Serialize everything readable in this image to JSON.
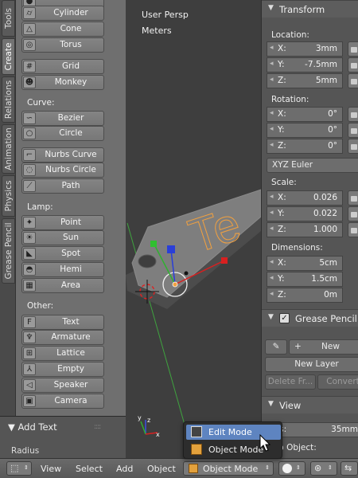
{
  "tabs": [
    {
      "label": "Tools",
      "active": false
    },
    {
      "label": "Create",
      "active": true
    },
    {
      "label": "Relations",
      "active": false
    },
    {
      "label": "Animation",
      "active": false
    },
    {
      "label": "Physics",
      "active": false
    },
    {
      "label": "Grease Pencil",
      "active": false
    }
  ],
  "toolshelf": {
    "buttons": [
      {
        "label": "Cylinder",
        "icon": "cylinder-icon",
        "glyph": "⌭"
      },
      {
        "label": "Cone",
        "icon": "cone-icon",
        "glyph": "△"
      },
      {
        "label": "Torus",
        "icon": "torus-icon",
        "glyph": "◎"
      },
      {
        "label": "Grid",
        "icon": "grid-icon",
        "glyph": "#"
      },
      {
        "label": "Monkey",
        "icon": "monkey-icon",
        "glyph": "☻"
      },
      {
        "label": "Bezier",
        "icon": "bezier-icon",
        "glyph": "∽"
      },
      {
        "label": "Circle",
        "icon": "circle-curve-icon",
        "glyph": "○"
      },
      {
        "label": "Nurbs Curve",
        "icon": "nurbs-curve-icon",
        "glyph": "⌐"
      },
      {
        "label": "Nurbs Circle",
        "icon": "nurbs-circle-icon",
        "glyph": "◌"
      },
      {
        "label": "Path",
        "icon": "path-icon",
        "glyph": "⟋"
      },
      {
        "label": "Point",
        "icon": "point-lamp-icon",
        "glyph": "✦"
      },
      {
        "label": "Sun",
        "icon": "sun-lamp-icon",
        "glyph": "☀"
      },
      {
        "label": "Spot",
        "icon": "spot-lamp-icon",
        "glyph": "◣"
      },
      {
        "label": "Hemi",
        "icon": "hemi-lamp-icon",
        "glyph": "◓"
      },
      {
        "label": "Area",
        "icon": "area-lamp-icon",
        "glyph": "▦"
      },
      {
        "label": "Text",
        "icon": "text-icon",
        "glyph": "F"
      },
      {
        "label": "Armature",
        "icon": "armature-icon",
        "glyph": "♆"
      },
      {
        "label": "Lattice",
        "icon": "lattice-icon",
        "glyph": "⊞"
      },
      {
        "label": "Empty",
        "icon": "empty-icon",
        "glyph": "⅄"
      },
      {
        "label": "Speaker",
        "icon": "speaker-icon",
        "glyph": "◁"
      },
      {
        "label": "Camera",
        "icon": "camera-icon",
        "glyph": "▣"
      }
    ],
    "section_curve": "Curve:",
    "section_lamp": "Lamp:",
    "section_other": "Other:"
  },
  "redo_panel": {
    "title": "Add Text",
    "field": "Radius"
  },
  "viewport": {
    "view_name": "User Persp",
    "units": "Meters",
    "object_text": "Te"
  },
  "properties": {
    "transform": {
      "title": "Transform",
      "location_label": "Location:",
      "location": [
        {
          "axis": "X:",
          "value": "3mm"
        },
        {
          "axis": "Y:",
          "value": "-7.5mm"
        },
        {
          "axis": "Z:",
          "value": "5mm"
        }
      ],
      "rotation_label": "Rotation:",
      "rotation": [
        {
          "axis": "X:",
          "value": "0°"
        },
        {
          "axis": "Y:",
          "value": "0°"
        },
        {
          "axis": "Z:",
          "value": "0°"
        }
      ],
      "rotation_mode": "XYZ Euler",
      "scale_label": "Scale:",
      "scale": [
        {
          "axis": "X:",
          "value": "0.026"
        },
        {
          "axis": "Y:",
          "value": "0.022"
        },
        {
          "axis": "Z:",
          "value": "1.000"
        }
      ],
      "dimensions_label": "Dimensions:",
      "dimensions": [
        {
          "axis": "X:",
          "value": "5cm"
        },
        {
          "axis": "Y:",
          "value": "1.5cm"
        },
        {
          "axis": "Z:",
          "value": "0m"
        }
      ]
    },
    "grease_pencil": {
      "title": "Grease Pencil",
      "new_label": "New",
      "new_layer_label": "New Layer",
      "delete_label": "Delete Fr...",
      "convert_label": "Convert"
    },
    "view": {
      "title": "View",
      "lens_label": "ens:",
      "lens_value": "35mm",
      "lock_label": "ck to Object:"
    }
  },
  "header": {
    "menu": [
      "View",
      "Select",
      "Add",
      "Object"
    ],
    "mode": "Object Mode"
  },
  "mode_popup": {
    "items": [
      {
        "label": "Edit Mode",
        "icon": "edit-mode-icon",
        "highlighted": true
      },
      {
        "label": "Object Mode",
        "icon": "object-mode-icon",
        "highlighted": false
      }
    ]
  },
  "colors": {
    "accent": "#5e84c0",
    "x_axis": "#e02020",
    "y_axis": "#20c020",
    "z_axis": "#2040e0",
    "text_outline": "#f0a040"
  }
}
